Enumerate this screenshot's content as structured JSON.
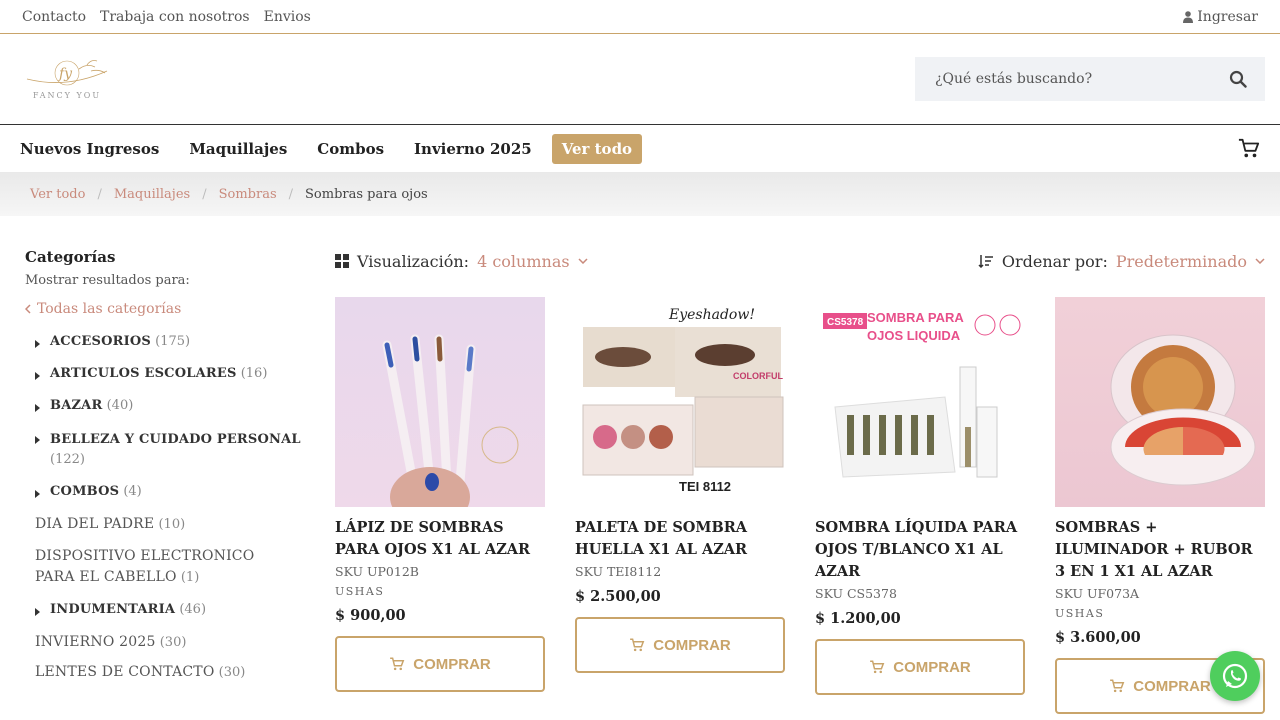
{
  "topbar": {
    "links": [
      "Contacto",
      "Trabaja con nosotros",
      "Envios"
    ],
    "login": "Ingresar"
  },
  "header": {
    "logo_mark": "fy",
    "logo_brand": "FANCY YOU",
    "search_placeholder": "¿Qué estás buscando?"
  },
  "nav": {
    "items": [
      "Nuevos Ingresos",
      "Maquillajes",
      "Combos",
      "Invierno 2025",
      "Ver todo"
    ]
  },
  "breadcrumb": {
    "items": [
      "Ver todo",
      "Maquillajes",
      "Sombras"
    ],
    "current": "Sombras para ojos"
  },
  "sidebar": {
    "title": "Categorías",
    "subtitle": "Mostrar resultados para:",
    "all_link": "Todas las categorías",
    "categories": [
      {
        "name": "ACCESORIOS",
        "count": "(175)"
      },
      {
        "name": "ARTICULOS ESCOLARES",
        "count": "(16)"
      },
      {
        "name": "BAZAR",
        "count": "(40)"
      },
      {
        "name": "BELLEZA Y CUIDADO PERSONAL",
        "count": "(122)"
      },
      {
        "name": "COMBOS",
        "count": "(4)"
      },
      {
        "name": "DIA DEL PADRE",
        "count": "(10)"
      },
      {
        "name": "DISPOSITIVO ELECTRONICO PARA EL CABELLO",
        "count": "(1)"
      },
      {
        "name": "INDUMENTARIA",
        "count": "(46)"
      },
      {
        "name": "INVIERNO 2025",
        "count": "(30)"
      },
      {
        "name": "LENTES DE CONTACTO",
        "count": "(30)"
      }
    ]
  },
  "controls": {
    "view_label": "Visualización:",
    "view_value": "4 columnas",
    "sort_label": "Ordenar por:",
    "sort_value": "Predeterminado"
  },
  "products": [
    {
      "title": "LÁPIZ DE SOMBRAS PARA OJOS X1 AL AZAR",
      "sku": "SKU UP012B",
      "brand": "USHAS",
      "price": "$  900,00",
      "buy": "COMPRAR"
    },
    {
      "title": "PALETA DE SOMBRA HUELLA X1 AL AZAR",
      "sku": "SKU TEI8112",
      "brand": "",
      "price": "$  2.500,00",
      "buy": "COMPRAR",
      "img_text": [
        "Eyeshadow!",
        "TEI 8112",
        "COLORFUL"
      ]
    },
    {
      "title": "SOMBRA LÍQUIDA PARA OJOS T/BLANCO X1 AL AZAR",
      "sku": "SKU CS5378",
      "brand": "",
      "price": "$  1.200,00",
      "buy": "COMPRAR",
      "img_text": [
        "CS5378",
        "SOMBRA PARA OJOS LIQUIDA"
      ]
    },
    {
      "title": "SOMBRAS + ILUMINADOR + RUBOR 3 EN 1 X1 AL AZAR",
      "sku": "SKU UF073A",
      "brand": "USHAS",
      "price": "$  3.600,00",
      "buy": "COMPRAR"
    }
  ],
  "colors": {
    "accent": "#c9a46a",
    "link": "#c98a7c",
    "whatsapp": "#4fce5d"
  }
}
